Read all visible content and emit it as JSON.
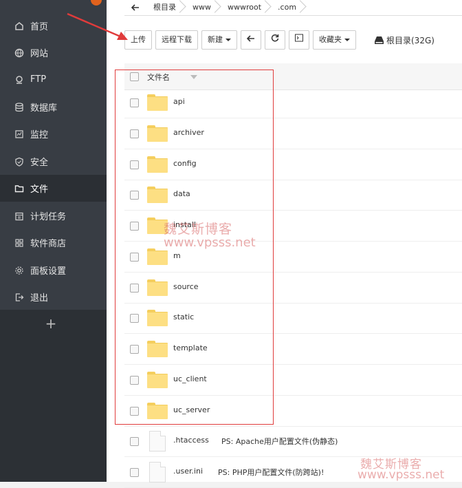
{
  "sidebar": {
    "items": [
      {
        "label": "首页",
        "icon": "home-icon"
      },
      {
        "label": "网站",
        "icon": "globe-icon"
      },
      {
        "label": "FTP",
        "icon": "ftp-icon"
      },
      {
        "label": "数据库",
        "icon": "database-icon"
      },
      {
        "label": "监控",
        "icon": "monitor-icon"
      },
      {
        "label": "安全",
        "icon": "shield-icon"
      },
      {
        "label": "文件",
        "icon": "folder-icon",
        "active": true
      },
      {
        "label": "计划任务",
        "icon": "calendar-icon"
      },
      {
        "label": "软件商店",
        "icon": "grid-icon"
      },
      {
        "label": "面板设置",
        "icon": "gear-icon"
      },
      {
        "label": "退出",
        "icon": "logout-icon"
      }
    ],
    "add_label": "+"
  },
  "breadcrumb": [
    "根目录",
    "www",
    "wwwroot",
    "       .com"
  ],
  "toolbar": {
    "upload": "上传",
    "remote_download": "远程下载",
    "new": "新建",
    "favorites": "收藏夹",
    "disk_label": "根目录(32G)"
  },
  "table": {
    "header": "文件名",
    "folders": [
      "api",
      "archiver",
      "config",
      "data",
      "install",
      "m",
      "source",
      "static",
      "template",
      "uc_client",
      "uc_server"
    ],
    "files": [
      {
        "name": ".htaccess",
        "note": "PS: Apache用户配置文件(伪静态)"
      },
      {
        "name": ".user.ini",
        "note": "PS: PHP用户配置文件(防跨站)!"
      }
    ]
  },
  "watermark": {
    "cn": "魏艾斯博客",
    "url": "www.vpsss.net"
  },
  "colors": {
    "sidebar_bg": "#383d44",
    "folder": "#fddf83",
    "annotation": "#e03b3b"
  }
}
